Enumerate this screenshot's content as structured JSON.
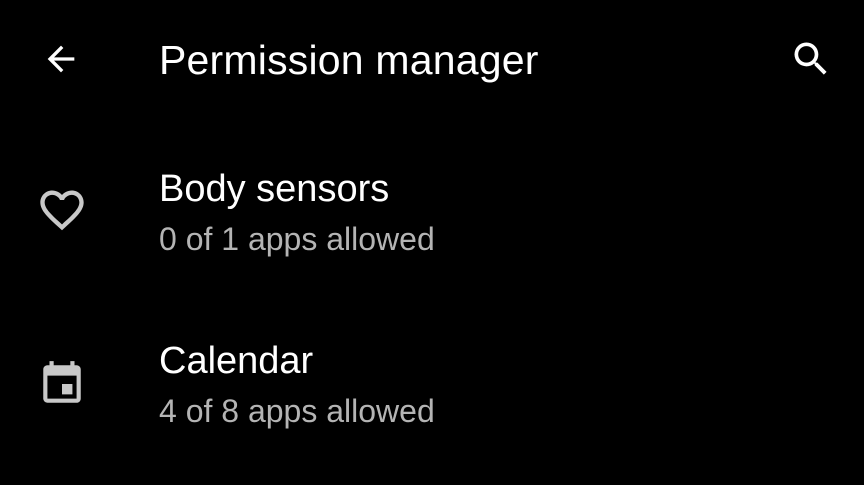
{
  "app_bar": {
    "title": "Permission manager",
    "back_icon": "arrow-back-icon",
    "search_icon": "search-icon"
  },
  "permissions": [
    {
      "icon": "heart-outline-icon",
      "title": "Body sensors",
      "subtitle": "0 of 1 apps allowed"
    },
    {
      "icon": "calendar-icon",
      "title": "Calendar",
      "subtitle": "4 of 8 apps allowed"
    }
  ],
  "colors": {
    "background": "#000000",
    "primary_text": "#ffffff",
    "secondary_text": "#b4b4b4",
    "icon": "#c8c8c8"
  }
}
